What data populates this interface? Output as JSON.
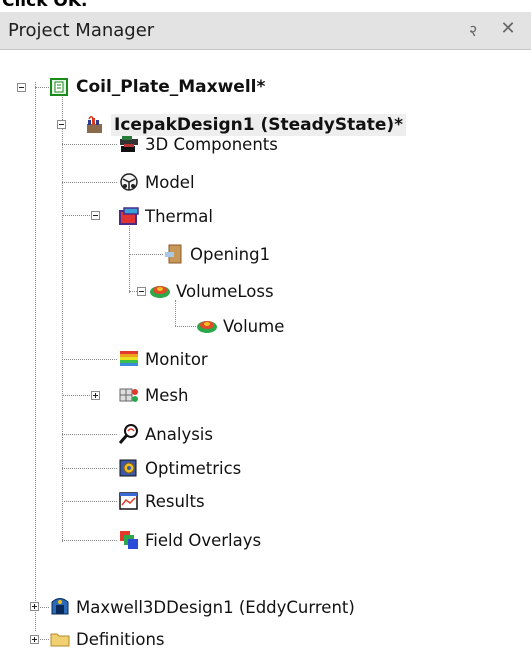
{
  "top_fragment": "Click OK.",
  "panel": {
    "title": "Project Manager",
    "pin_glyph": "२",
    "close_glyph": "✕"
  },
  "tree": {
    "project": {
      "label": "Coil_Plate_Maxwell*",
      "icon": "project-icon",
      "children": {
        "icepak": {
          "label": "IcepakDesign1 (SteadyState)*",
          "icon": "icepak-design-icon",
          "selected": true,
          "items": {
            "components": {
              "label": "3D Components",
              "icon": "3d-components-icon"
            },
            "model": {
              "label": "Model",
              "icon": "model-icon"
            },
            "thermal": {
              "label": "Thermal",
              "icon": "thermal-icon",
              "opening": {
                "label": "Opening1",
                "icon": "opening-icon"
              },
              "volumeloss": {
                "label": "VolumeLoss",
                "icon": "volume-loss-icon",
                "volume": {
                  "label": "Volume",
                  "icon": "volume-icon"
                }
              }
            },
            "monitor": {
              "label": "Monitor",
              "icon": "monitor-icon"
            },
            "mesh": {
              "label": "Mesh",
              "icon": "mesh-icon"
            },
            "analysis": {
              "label": "Analysis",
              "icon": "analysis-icon"
            },
            "optimetrics": {
              "label": "Optimetrics",
              "icon": "optimetrics-icon"
            },
            "results": {
              "label": "Results",
              "icon": "results-icon"
            },
            "field_overlays": {
              "label": "Field Overlays",
              "icon": "field-overlays-icon"
            }
          }
        },
        "maxwell": {
          "label": "Maxwell3DDesign1 (EddyCurrent)",
          "icon": "maxwell-design-icon"
        },
        "definitions": {
          "label": "Definitions",
          "icon": "folder-icon"
        }
      }
    }
  }
}
